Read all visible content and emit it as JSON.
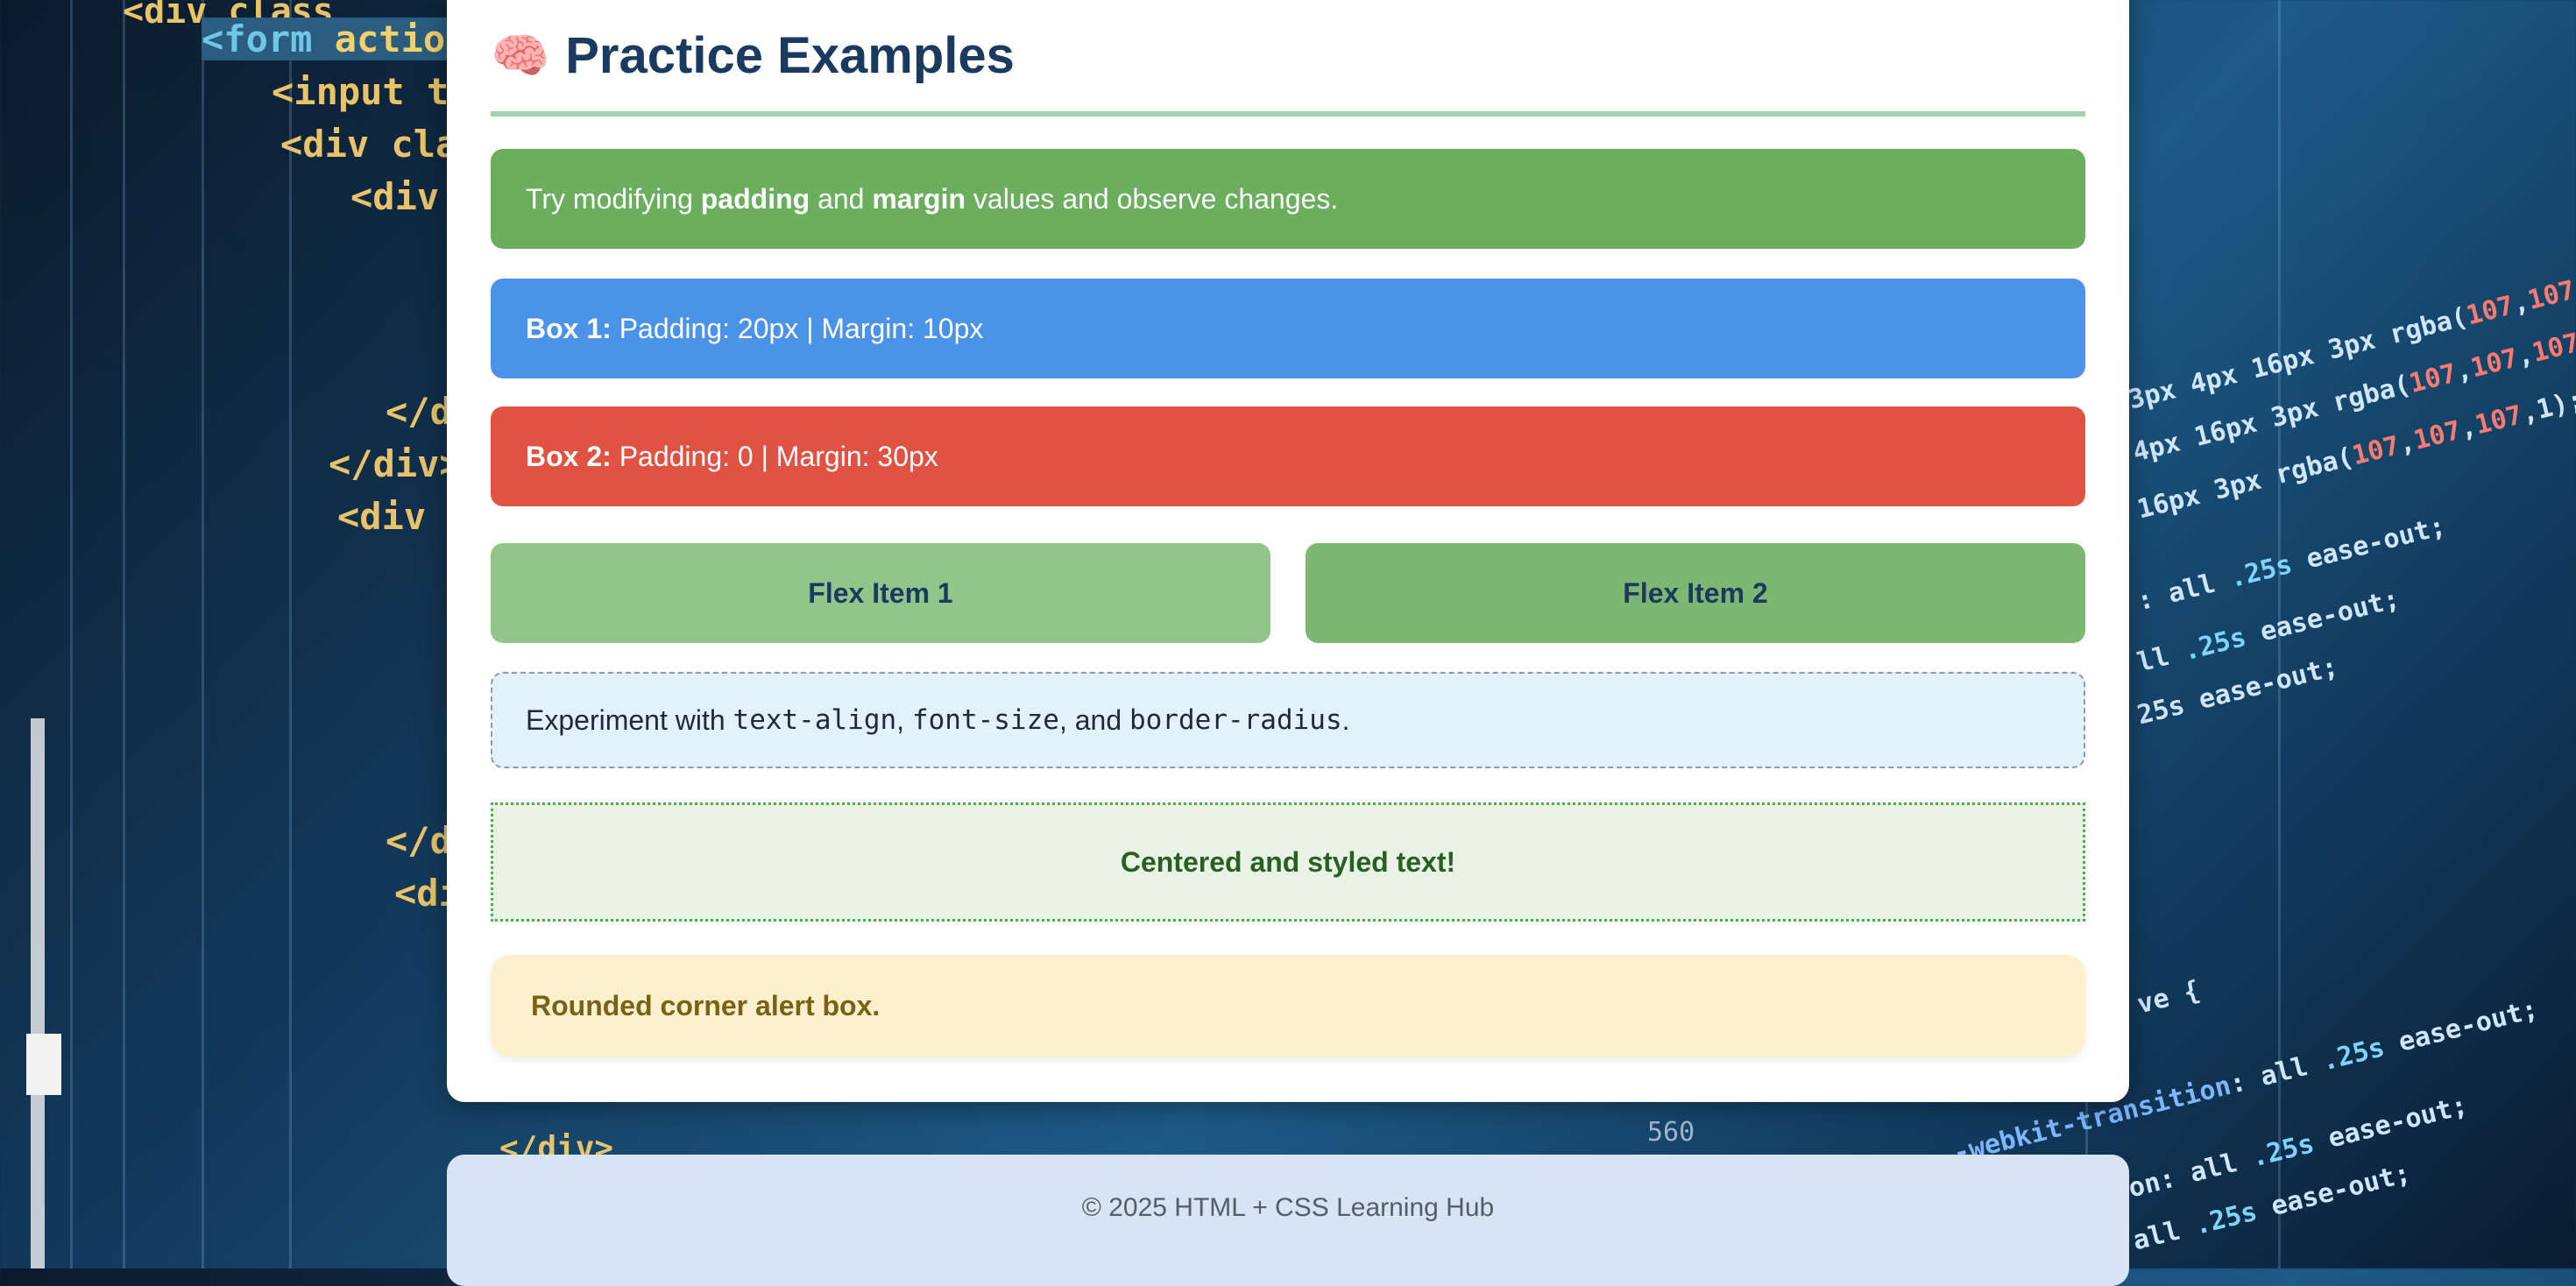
{
  "page": {
    "title": "Practice Examples",
    "title_icon": "brain-icon",
    "title_icon_glyph": "🧠"
  },
  "colors": {
    "title": "#1a3a5f",
    "green_box": "#6aae5e",
    "blue_box": "#4a93e9",
    "red_box": "#e05342",
    "flex_item_1": "#92c589",
    "flex_item_2": "#7cb872",
    "experiment_bg": "#e3f1fb",
    "centered_bg": "#e8f3e6",
    "alert_bg": "#fdf1cd",
    "footer_bg": "#d8e3f4"
  },
  "tip": {
    "prefix": "Try modifying ",
    "padding_word": "padding",
    "middle": " and ",
    "margin_word": "margin",
    "suffix": " values and observe changes."
  },
  "box1": {
    "label": "Box 1:",
    "text": " Padding: 20px | Margin: 10px"
  },
  "box2": {
    "label": "Box 2:",
    "text": " Padding: 0 | Margin: 30px"
  },
  "flex": {
    "item1": "Flex Item 1",
    "item2": "Flex Item 2"
  },
  "experiment": {
    "prefix": "Experiment with ",
    "code1": "text-align",
    "sep1": ", ",
    "code2": "font-size",
    "sep2": ", and ",
    "code3": "border-radius",
    "suffix": "."
  },
  "centered_text": "Centered and styled text!",
  "alert_text": "Rounded corner alert box.",
  "footer": "© 2025 HTML + CSS Learning Hub"
}
